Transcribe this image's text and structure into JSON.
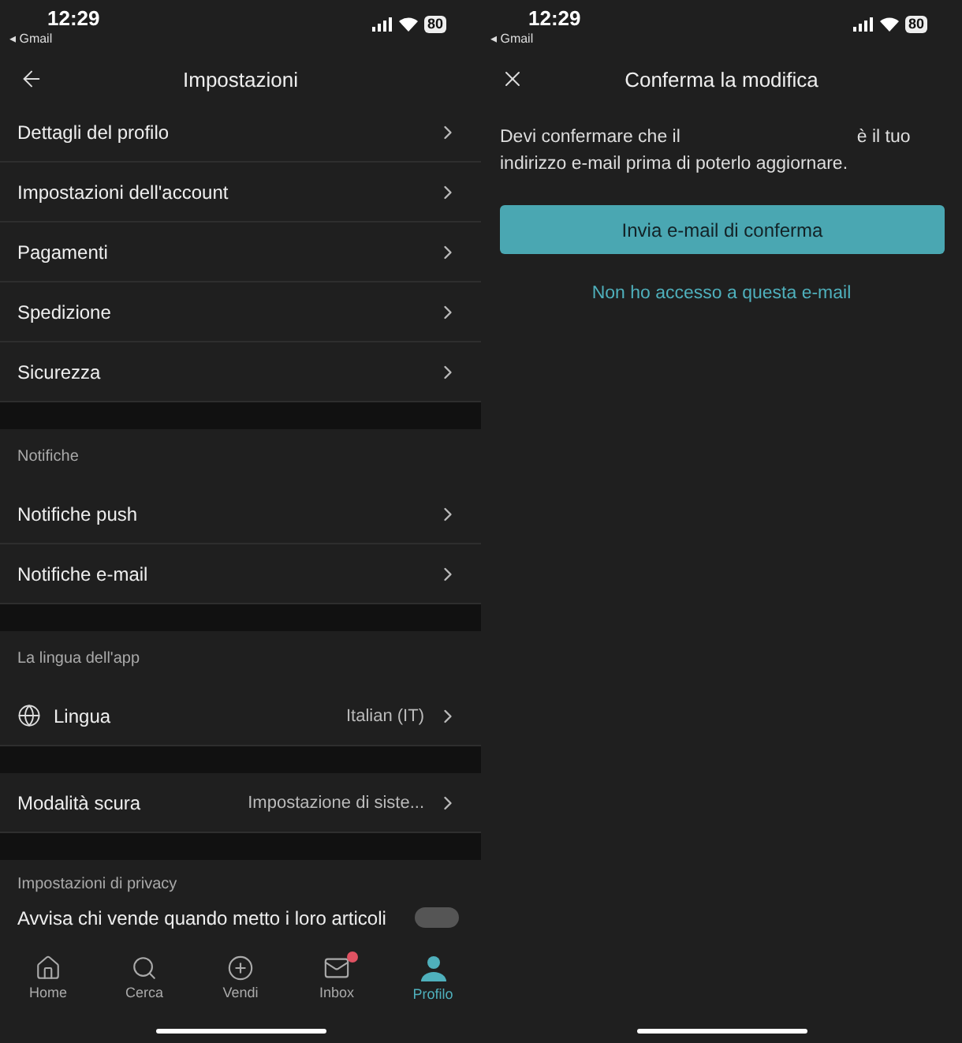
{
  "settings_screen": {
    "status_bar": {
      "time": "12:29",
      "back_app": "◂ Gmail",
      "battery": "80"
    },
    "header": {
      "title": "Impostazioni"
    },
    "sections": [
      {
        "items": [
          {
            "kind": "plain",
            "label": "Dettagli del profilo"
          },
          {
            "kind": "plain",
            "label": "Impostazioni dell'account"
          },
          {
            "kind": "plain",
            "label": "Pagamenti"
          },
          {
            "kind": "plain",
            "label": "Spedizione"
          },
          {
            "kind": "plain",
            "label": "Sicurezza"
          }
        ]
      },
      {
        "title": "Notifiche",
        "items": [
          {
            "kind": "plain",
            "label": "Notifiche push"
          },
          {
            "kind": "plain",
            "label": "Notifiche e-mail"
          }
        ]
      },
      {
        "title": "La lingua dell'app",
        "items": [
          {
            "kind": "with_icon",
            "label": "Lingua",
            "value": "Italian (IT)"
          }
        ]
      },
      {
        "items": [
          {
            "kind": "plain",
            "label": "Modalità scura",
            "value": "Impostazione di siste..."
          }
        ]
      },
      {
        "title": "Impostazioni di privacy",
        "items": [
          {
            "kind": "toggle",
            "label": "Avvisa chi vende quando metto i loro articoli",
            "on": false
          }
        ]
      }
    ],
    "tab_bar": [
      {
        "label": "Home",
        "selected": false,
        "badge": false
      },
      {
        "label": "Cerca",
        "selected": false,
        "badge": false
      },
      {
        "label": "Vendi",
        "selected": false,
        "badge": false
      },
      {
        "label": "Inbox",
        "selected": false,
        "badge": true
      },
      {
        "label": "Profilo",
        "selected": true,
        "badge": false
      }
    ]
  },
  "confirm_screen": {
    "status_bar": {
      "time": "12:29",
      "back_app": "◂ Gmail",
      "battery": "80"
    },
    "header": {
      "title": "Conferma la modifica"
    },
    "message_before": "Devi confermare che il",
    "message_after": "è il tuo indirizzo e-mail prima di poterlo aggiornare.",
    "primary_button": "Invia e-mail di conferma",
    "link": "Non ho accesso a questa e-mail"
  }
}
